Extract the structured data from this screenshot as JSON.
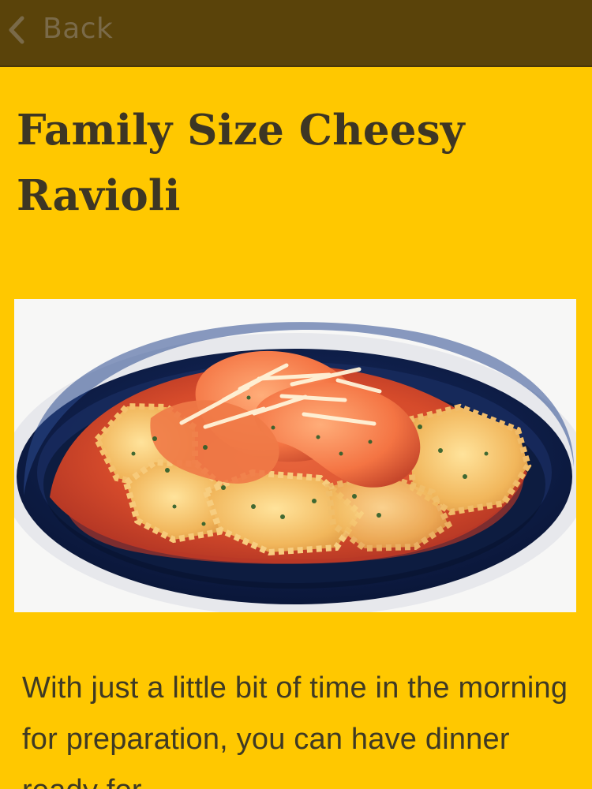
{
  "topbar": {
    "back_label": "Back",
    "icon": "chevron-left-icon",
    "background_color": "#5a430a"
  },
  "content": {
    "title": "Family Size Cheesy Ravioli",
    "image_alt": "",
    "description": "With just a little bit of time in the morning for preparation, you can have dinner ready for"
  },
  "colors": {
    "page_background": "#ffc800",
    "title_text": "#3d3624",
    "body_text": "#3f3a24",
    "back_text": "#7a6a49"
  }
}
